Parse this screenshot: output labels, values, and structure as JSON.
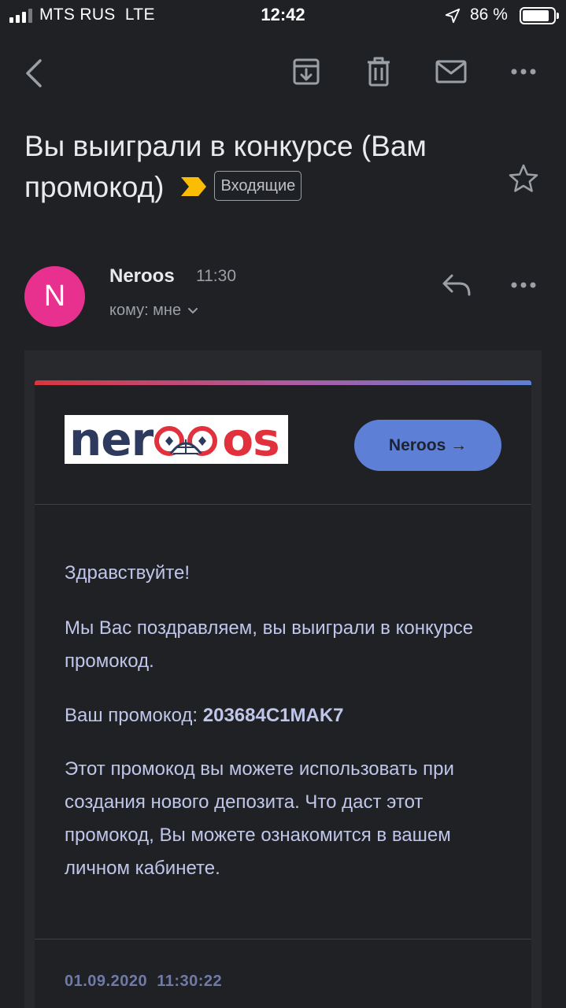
{
  "status_bar": {
    "carrier": "MTS RUS",
    "network": "LTE",
    "time": "12:42",
    "battery": "86 %",
    "battery_level": 0.86
  },
  "toolbar": {
    "icons": [
      "back-arrow-icon",
      "archive-icon",
      "trash-icon",
      "mail-icon",
      "more-horizontal-icon"
    ]
  },
  "email": {
    "subject": "Вы выиграли в конкурсе (Вам промокод)",
    "label": "Входящие",
    "sender": {
      "initial": "N",
      "name": "Neroos",
      "time": "11:30",
      "recipient": "кому: мне",
      "avatar_color": "#e8308f"
    },
    "body": {
      "logo": {
        "part_dark": "ner",
        "part_red": "os"
      },
      "button_label": "Neroos →",
      "greeting": "Здравствуйте!",
      "paragraph1": "Мы Вас поздравляем, вы выиграли в конкурсе промокод.",
      "promo_prefix": "Ваш промокод: ",
      "promo_code": "203684C1MAK7",
      "paragraph2": "Этот промокод вы можете использовать при создания нового депозита. Что даст этот промокод, Вы можете ознакомится в вашем личном кабинете.",
      "footer_datetime": "01.09.2020  11:30:22"
    }
  },
  "colors": {
    "background": "#202124",
    "accent_blue": "#5d7fd6",
    "accent_red": "#e0313d",
    "importance_marker": "#fbbc04"
  }
}
